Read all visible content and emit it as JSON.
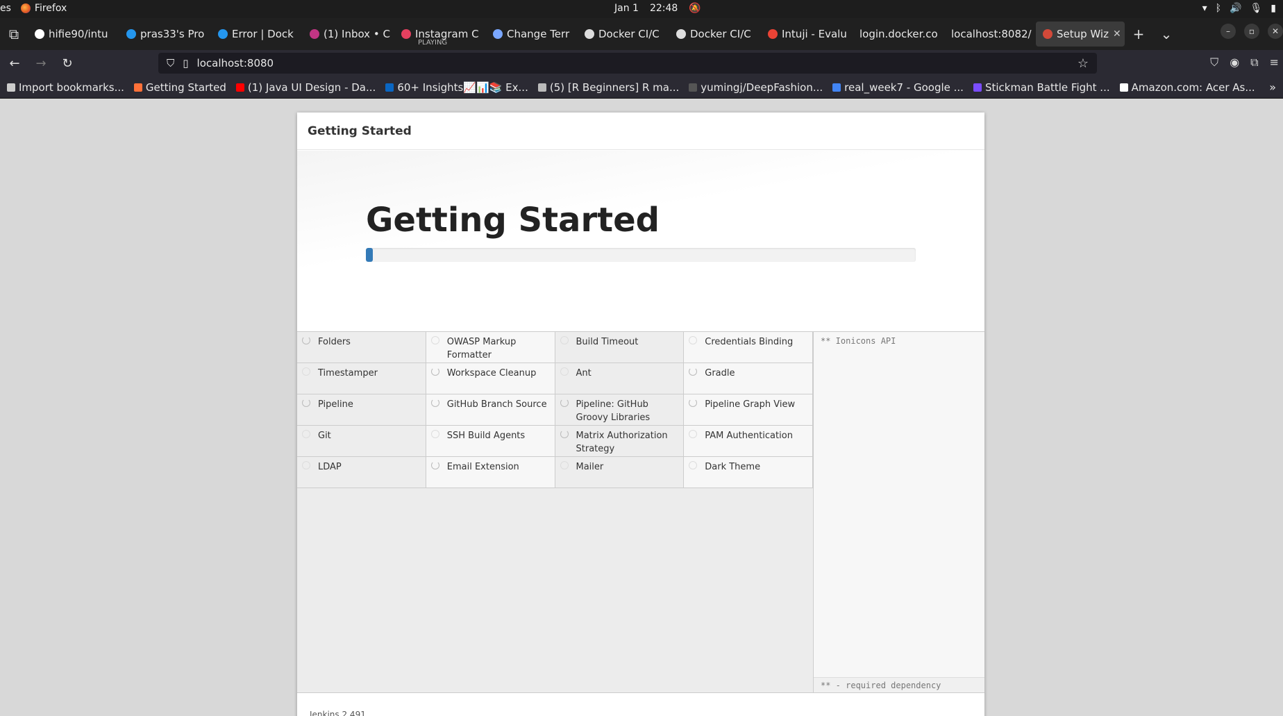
{
  "system_bar": {
    "activities": "es",
    "app_name": "Firefox",
    "date": "Jan 1",
    "time": "22:48"
  },
  "tabs": [
    {
      "label": "hifie90/intu",
      "icon": "github-icon",
      "color": "#ffffff"
    },
    {
      "label": "pras33's Pro",
      "icon": "docker-icon",
      "color": "#2496ed"
    },
    {
      "label": "Error | Dock",
      "icon": "docker-icon",
      "color": "#2496ed"
    },
    {
      "label": "(1) Inbox • C",
      "icon": "instagram-icon",
      "color": "#c13584"
    },
    {
      "label": "Instagram C",
      "sub": "PLAYING",
      "icon": "instagram-icon",
      "color": "#e4405f"
    },
    {
      "label": "Change Terr",
      "icon": "hourglass-icon",
      "color": "#7aa7ff"
    },
    {
      "label": "Docker CI/C",
      "icon": "openai-icon",
      "color": "#dddddd"
    },
    {
      "label": "Docker CI/C",
      "icon": "openai-icon",
      "color": "#dddddd"
    },
    {
      "label": "Intuji - Evalu",
      "icon": "gmail-icon",
      "color": "#ea4335"
    },
    {
      "label": "login.docker.co",
      "icon": "",
      "color": ""
    },
    {
      "label": "localhost:8082/",
      "icon": "",
      "color": ""
    },
    {
      "label": "Setup Wiz",
      "icon": "jenkins-icon",
      "color": "#d24939",
      "active": true
    }
  ],
  "navbar": {
    "url": "localhost:8080"
  },
  "bookmarks": [
    {
      "label": "Import bookmarks...",
      "icon": "import-icon",
      "color": "#cccccc"
    },
    {
      "label": "Getting Started",
      "icon": "firefox-icon",
      "color": "#ff7139"
    },
    {
      "label": "(1) Java UI Design - Da...",
      "icon": "youtube-icon",
      "color": "#ff0000"
    },
    {
      "label": "60+ Insights📈📊📚 Ex...",
      "icon": "k-icon",
      "color": "#0a66c2"
    },
    {
      "label": "(5) [R Beginners] R ma...",
      "icon": "globe-icon",
      "color": "#bbbbbb"
    },
    {
      "label": "yumingj/DeepFashion...",
      "icon": "github-icon",
      "color": "#555555"
    },
    {
      "label": "real_week7 - Google ...",
      "icon": "docs-icon",
      "color": "#4285f4"
    },
    {
      "label": "Stickman Battle Fight ...",
      "icon": "game-icon",
      "color": "#7b4dff"
    },
    {
      "label": "Amazon.com: Acer As...",
      "icon": "amazon-icon",
      "color": "#ffffff"
    }
  ],
  "setup": {
    "header": "Getting Started",
    "title": "Getting Started",
    "progress": 0.012,
    "plugins": [
      {
        "name": "Folders",
        "state": "installing"
      },
      {
        "name": "OWASP Markup Formatter",
        "state": "pending"
      },
      {
        "name": "Build Timeout",
        "state": "pending"
      },
      {
        "name": "Credentials Binding",
        "state": "pending"
      },
      {
        "name": "Timestamper",
        "state": "pending"
      },
      {
        "name": "Workspace Cleanup",
        "state": "installing"
      },
      {
        "name": "Ant",
        "state": "pending"
      },
      {
        "name": "Gradle",
        "state": "installing"
      },
      {
        "name": "Pipeline",
        "state": "installing"
      },
      {
        "name": "GitHub Branch Source",
        "state": "installing"
      },
      {
        "name": "Pipeline: GitHub Groovy Libraries",
        "state": "installing"
      },
      {
        "name": "Pipeline Graph View",
        "state": "installing"
      },
      {
        "name": "Git",
        "state": "pending"
      },
      {
        "name": "SSH Build Agents",
        "state": "pending"
      },
      {
        "name": "Matrix Authorization Strategy",
        "state": "installing"
      },
      {
        "name": "PAM Authentication",
        "state": "pending"
      },
      {
        "name": "LDAP",
        "state": "pending"
      },
      {
        "name": "Email Extension",
        "state": "installing"
      },
      {
        "name": "Mailer",
        "state": "pending"
      },
      {
        "name": "Dark Theme",
        "state": "pending"
      }
    ],
    "log_line": "** Ionicons API",
    "log_footer": "** - required dependency",
    "version": "Jenkins 2.491"
  }
}
